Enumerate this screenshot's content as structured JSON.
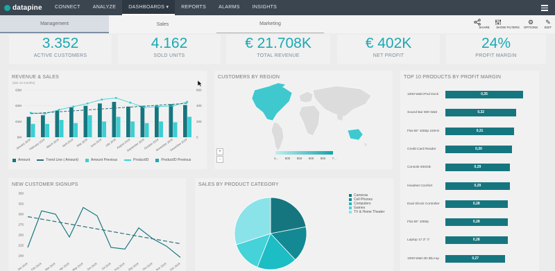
{
  "app": {
    "brand": "datapine"
  },
  "nav": {
    "items": [
      "CONNECT",
      "ANALYZE",
      "DASHBOARDS ▾",
      "REPORTS",
      "ALARMS",
      "INSIGHTS"
    ],
    "active_index": 2
  },
  "subtabs": [
    "Management",
    "Sales",
    "Marketing"
  ],
  "tools": [
    {
      "label": "SHARE",
      "icon": "share-icon"
    },
    {
      "label": "SHOW FILTERS",
      "icon": "filter-icon"
    },
    {
      "label": "OPTIONS",
      "icon": "gear-icon"
    },
    {
      "label": "EDIT",
      "icon": "pencil-icon"
    }
  ],
  "kpis": [
    {
      "value": "3.352",
      "label": "ACTIVE CUSTOMERS"
    },
    {
      "value": "4.162",
      "label": "SOLD UNITS"
    },
    {
      "value": "€ 21.708K",
      "label": "TOTAL REVENUE"
    },
    {
      "value": "€ 402K",
      "label": "NET PROFIT"
    },
    {
      "value": "24%",
      "label": "PROFIT MARGIN"
    }
  ],
  "colors": {
    "teal_dark": "#16767f",
    "teal": "#1aa9b4",
    "teal_light": "#3ccfd4",
    "nav_bg": "#3a4550"
  },
  "revenue": {
    "title": "REVENUE & SALES",
    "subtitle": "(last 12 months)",
    "legend": [
      "Amount",
      "Trend Line ( Amount)",
      "Amount Previous",
      "ProductID",
      "ProductID Previous"
    ],
    "chart_data": {
      "type": "bar",
      "categories": [
        "January 2019",
        "February 2019",
        "March 2019",
        "April 2019",
        "May 2019",
        "June 2019",
        "July 2019",
        "August 2019",
        "September 2019",
        "October 2019",
        "November 2019",
        "December 2019"
      ],
      "left_ticks": [
        "€3M",
        "€2M",
        "€1M",
        "€M"
      ],
      "right_ticks": [
        "600",
        "400",
        "200",
        "0"
      ],
      "y_range": [
        0,
        3000000
      ],
      "y2_range": [
        0,
        600
      ],
      "series": [
        {
          "name": "Amount",
          "values": [
            1300000,
            1400000,
            1700000,
            1900000,
            2000000,
            2150000,
            2250000,
            1950000,
            2000000,
            2000000,
            2100000,
            2050000
          ]
        },
        {
          "name": "Amount Previous",
          "values": [
            850000,
            850000,
            1100000,
            900000,
            1400000,
            1000000,
            1300000,
            1000000,
            900000,
            1000000,
            950000,
            1300000
          ]
        },
        {
          "name": "ProductID",
          "values": [
            310,
            300,
            350,
            390,
            430,
            480,
            500,
            440,
            380,
            390,
            400,
            450
          ]
        },
        {
          "name": "Trend Line ( Amount)",
          "values": [
            1500000,
            1560000,
            1620000,
            1680000,
            1740000,
            1800000,
            1860000,
            1920000,
            1980000,
            2040000,
            2100000,
            2160000
          ]
        }
      ]
    }
  },
  "region": {
    "title": "CUSTOMERS BY REGION",
    "scale_labels": [
      "4...",
      "500",
      "550",
      "600",
      "650",
      "7..."
    ],
    "zoom_in": "+",
    "zoom_out": "-"
  },
  "products": {
    "title": "TOP 10 PRODUCTS BY PROFIT MARGIN",
    "chart_data": {
      "type": "bar",
      "categories": [
        "1000-Watt iPod Dock",
        "Sound Bar 600 Watt",
        "Flat 55\" 1080p 240Hz",
        "Credit Card Reader",
        "Console 500GB",
        "Headset Comfort",
        "Dual Shock Controller",
        "Flat 55\" 1080p",
        "Laptop 17.3\" i7",
        "1000-Watt 3D Blu-ray"
      ],
      "values": [
        0.35,
        0.32,
        0.31,
        0.3,
        0.29,
        0.29,
        0.28,
        0.28,
        0.28,
        0.27
      ],
      "labels": [
        "0,35",
        "0,32",
        "0,31",
        "0,30",
        "0,29",
        "0,29",
        "0,28",
        "0,28",
        "0,28",
        "0,27"
      ]
    }
  },
  "signups": {
    "title": "NEW CUSTOMER SIGNUPS",
    "chart_data": {
      "type": "line",
      "categories": [
        "Jan 2019",
        "Feb 2019",
        "Mar 2019",
        "Apr 2019",
        "May 2019",
        "Jun 2019",
        "Jul 2019",
        "Aug 2019",
        "Sep 2019",
        "Oct 2019",
        "Nov 2019",
        "Dec 2019"
      ],
      "y_ticks": [
        "350",
        "325",
        "300",
        "275",
        "250",
        "225",
        "200"
      ],
      "y_range": [
        200,
        350
      ],
      "series": [
        {
          "name": "Signups",
          "values": [
            220,
            308,
            300,
            245,
            316,
            296,
            220,
            216,
            267,
            241,
            223,
            196
          ]
        },
        {
          "name": "Trend",
          "values": [
            294,
            289,
            283,
            277,
            271,
            265,
            259,
            253,
            247,
            241,
            235,
            229
          ]
        }
      ]
    }
  },
  "categories": {
    "title": "SALES BY PRODUCT CATEGORY",
    "chart_data": {
      "type": "pie",
      "labels": [
        "Cameras",
        "Cell Phones",
        "Computers",
        "Games",
        "TV & Home Theater"
      ],
      "values": [
        22,
        16,
        18,
        14,
        30
      ],
      "colors": [
        "#16767f",
        "#138a93",
        "#1cbdc4",
        "#45d2d8",
        "#8ae3e8"
      ]
    }
  }
}
